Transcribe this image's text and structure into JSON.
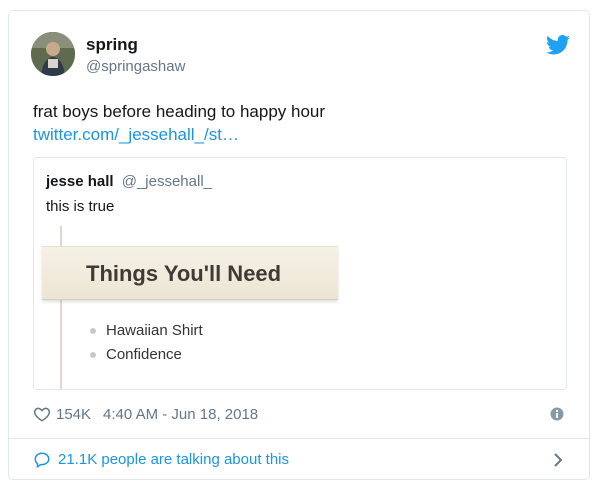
{
  "author": {
    "name": "spring",
    "handle": "@springashaw"
  },
  "tweet": {
    "text": "frat boys before heading to happy hour",
    "link_text": "twitter.com/_jessehall_/st…"
  },
  "quote": {
    "author_name": "jesse hall",
    "author_handle": "@_jessehall_",
    "text": "this is true",
    "media": {
      "heading": "Things You'll Need",
      "items": [
        "Hawaiian Shirt",
        "Confidence"
      ]
    }
  },
  "meta": {
    "like_count": "154K",
    "timestamp": "4:40 AM - Jun 18, 2018"
  },
  "conversation": {
    "text": "21.1K people are talking about this"
  },
  "icons": {
    "brand": "twitter-bird-icon",
    "like": "heart-icon",
    "info": "info-icon",
    "reply": "speech-bubble-icon",
    "more": "chevron-right-icon"
  },
  "colors": {
    "link": "#1b95e0",
    "secondary_text": "#657786",
    "border": "#e1e8ed"
  }
}
